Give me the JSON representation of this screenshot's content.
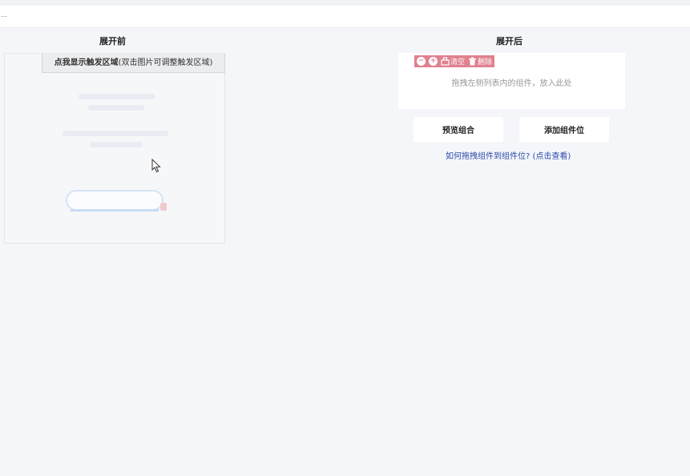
{
  "header": {
    "overflow_dots": "..."
  },
  "left": {
    "title": "展开前",
    "trigger_button": {
      "bold": "点我显示触发区域",
      "note": "(双击图片可调整触发区域)"
    }
  },
  "right": {
    "title": "展开后",
    "toolbar": {
      "clear_label": "清空",
      "delete_label": "删除",
      "color": "#e0818f"
    },
    "drop_hint": "拖拽左侧列表内的组件，放入此处",
    "preview_button": "预览组合",
    "add_slot_button": "添加组件位",
    "help_link": "如何拖拽组件到组件位? (点击查看)"
  },
  "icons": [
    "minus-circle-icon",
    "plus-circle-icon",
    "clear-icon",
    "trash-icon",
    "mouse-cursor-icon"
  ]
}
